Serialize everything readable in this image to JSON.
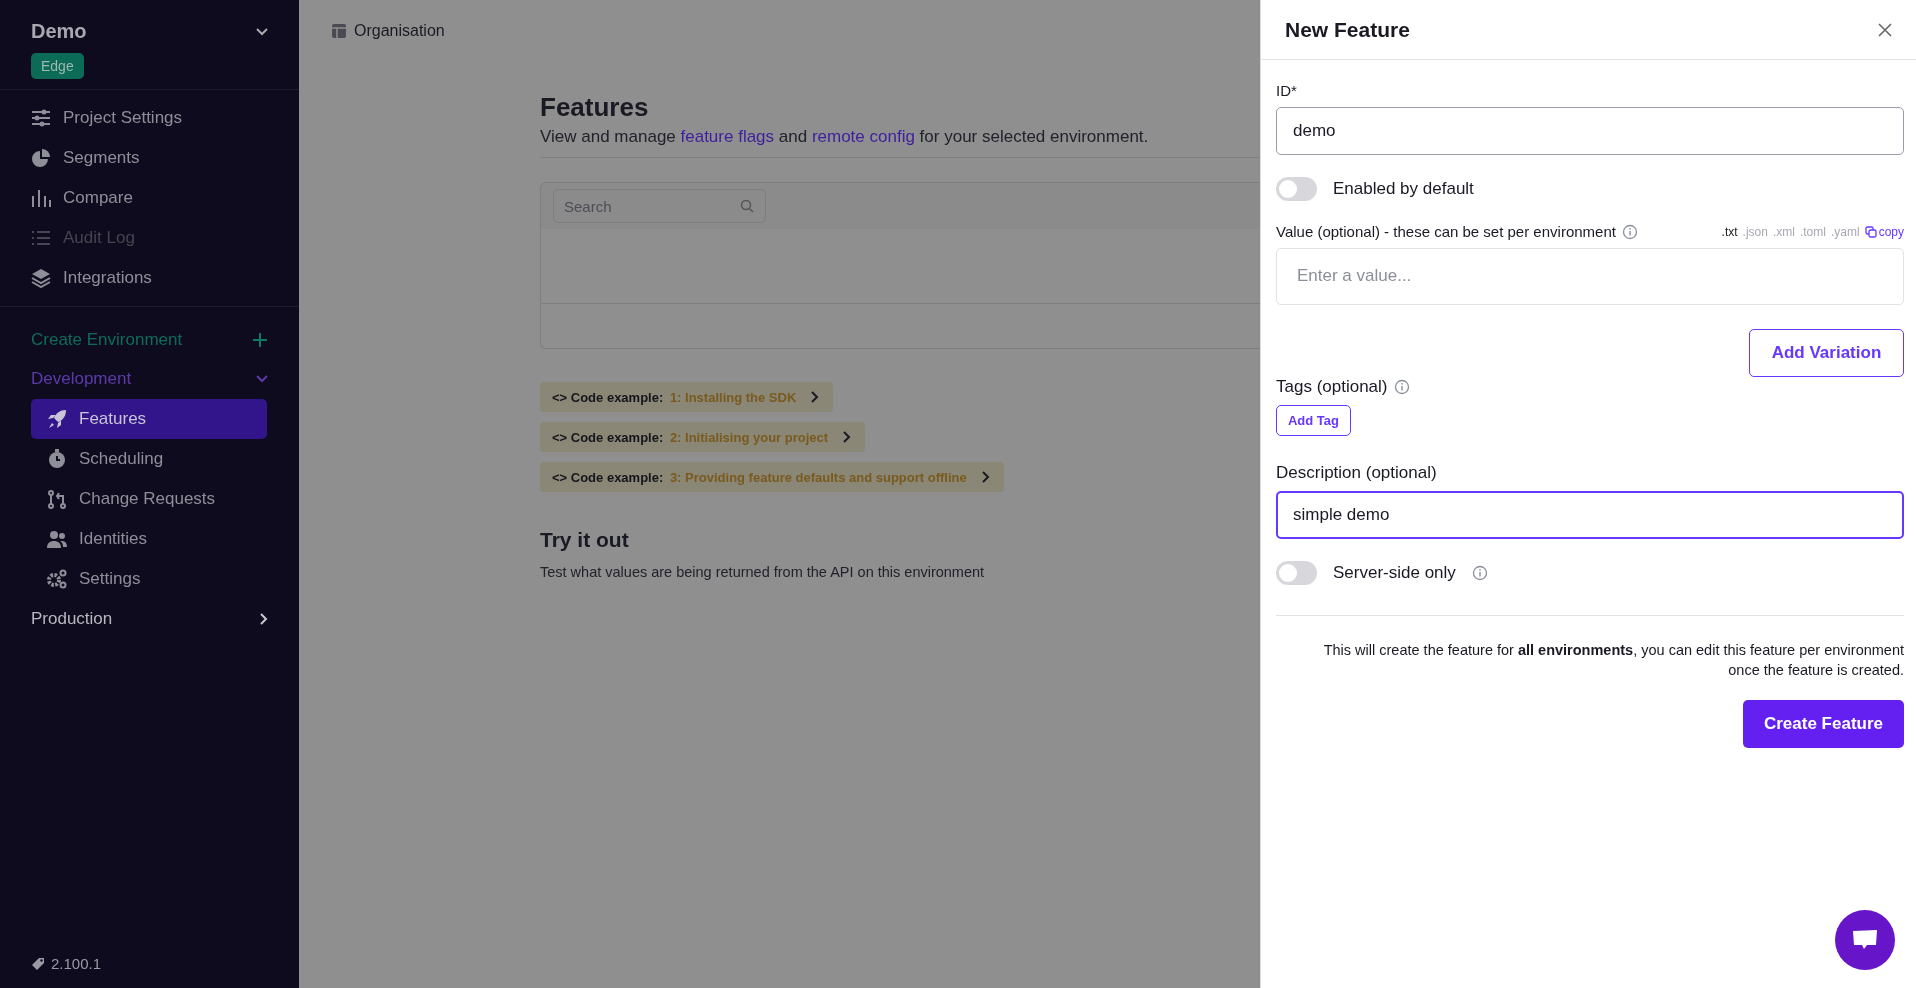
{
  "sidebar": {
    "project": {
      "name": "Demo",
      "badge": "Edge"
    },
    "nav": [
      {
        "label": "Project Settings",
        "disabled": false
      },
      {
        "label": "Segments",
        "disabled": false
      },
      {
        "label": "Compare",
        "disabled": false
      },
      {
        "label": "Audit Log",
        "disabled": true
      },
      {
        "label": "Integrations",
        "disabled": false
      }
    ],
    "create_environment": "Create Environment",
    "environments": [
      {
        "name": "Development",
        "expanded": true,
        "items": [
          {
            "label": "Features",
            "selected": true
          },
          {
            "label": "Scheduling",
            "selected": false
          },
          {
            "label": "Change Requests",
            "selected": false
          },
          {
            "label": "Identities",
            "selected": false
          },
          {
            "label": "Settings",
            "selected": false
          }
        ]
      },
      {
        "name": "Production",
        "expanded": false
      }
    ],
    "version": "2.100.1"
  },
  "breadcrumb": "Organisation",
  "page": {
    "title": "Features",
    "subtitle": [
      {
        "kind": "text",
        "text": "View and manage "
      },
      {
        "kind": "link",
        "text": "feature flags"
      },
      {
        "kind": "text",
        "text": " and "
      },
      {
        "kind": "link",
        "text": "remote config"
      },
      {
        "kind": "text",
        "text": " for your selected environment."
      }
    ],
    "search": {
      "placeholder": "Search"
    },
    "code_examples": [
      {
        "prefix": "<> Code example:",
        "label": "1: Installing the SDK"
      },
      {
        "prefix": "<> Code example:",
        "label": "2: Initialising your project"
      },
      {
        "prefix": "<> Code example:",
        "label": "3: Providing feature defaults and support offline"
      }
    ],
    "try_title": "Try it out",
    "try_text": "Test what values are being returned from the API on this environment"
  },
  "panel": {
    "title": "New Feature",
    "id_field": {
      "label": "ID*",
      "value": "demo"
    },
    "enabled_toggle": {
      "label": "Enabled by default",
      "on": false
    },
    "value_field": {
      "label": "Value (optional) - these can be set per environment",
      "placeholder": "Enter a value...",
      "formats": [
        {
          "label": ".txt",
          "selected": true
        },
        {
          "label": ".json",
          "selected": false
        },
        {
          "label": ".xml",
          "selected": false
        },
        {
          "label": ".toml",
          "selected": false
        },
        {
          "label": ".yaml",
          "selected": false
        }
      ],
      "copy": "copy"
    },
    "add_variation": "Add Variation",
    "tags": {
      "label": "Tags (optional)",
      "button": "Add Tag"
    },
    "description_field": {
      "label": "Description (optional)",
      "value": "simple demo",
      "focused": true
    },
    "server_toggle": {
      "label": "Server-side only",
      "on": false
    },
    "note": "This will create the feature for **all environments**, you can edit this feature per environment once the feature is created.",
    "create_button": "Create Feature"
  }
}
